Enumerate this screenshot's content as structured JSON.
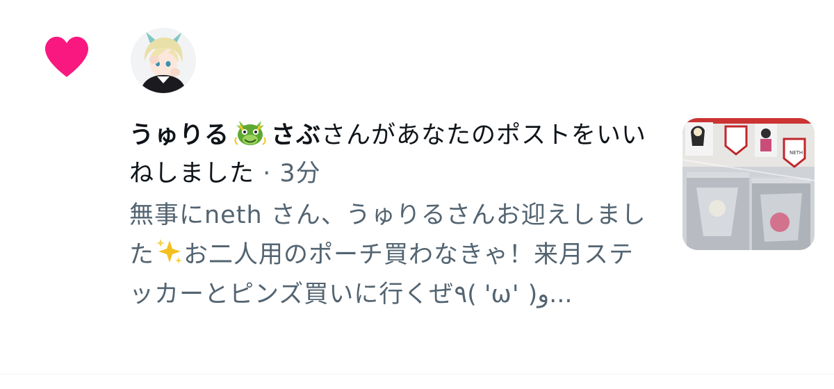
{
  "notification": {
    "user_name": "うゅりる",
    "user_name_suffix": "さぶ",
    "action_text": "さんがあなたのポストをいいねしました",
    "separator": " · ",
    "time": "3分",
    "post_text_part1": "無事にneth さん、うゅりるさんお迎えしました",
    "post_text_part2": "お二人用のポーチ買わなきゃ！来月ステッカーとピンズ買いに行くぜ٩( 'ω' )و...",
    "thumbnail_label": "NETH"
  },
  "colors": {
    "heart": "#f91880",
    "primary_text": "#0f1419",
    "secondary_text": "#536471"
  },
  "icons": {
    "heart": "heart-icon",
    "dragon": "dragon-emoji-icon",
    "sparkles": "sparkles-emoji-icon"
  }
}
